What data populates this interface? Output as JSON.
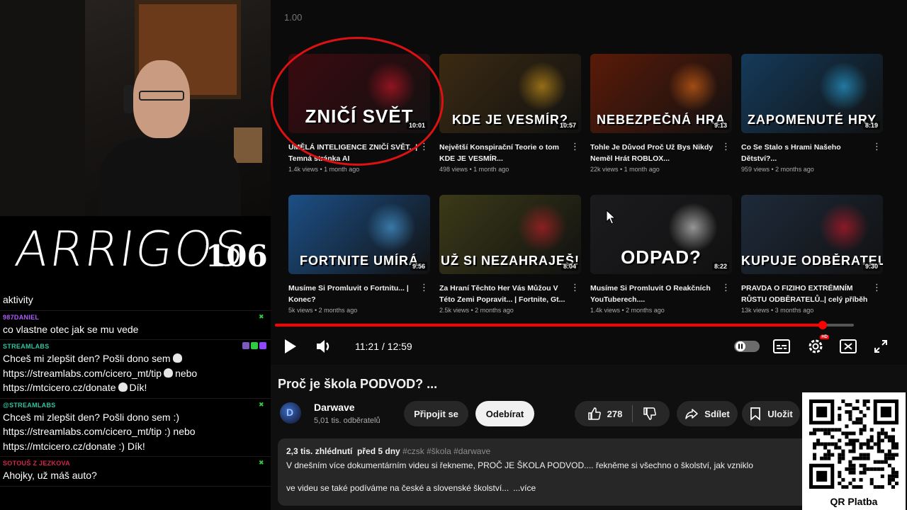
{
  "stream": {
    "logo_text": "ARRIGOS",
    "counter": "106"
  },
  "chat": {
    "messages": [
      {
        "user": "",
        "text": "aktivity",
        "user_color": "#9146ff"
      },
      {
        "user": "987DANIEL",
        "text": "co vlastne otec jak se mu vede",
        "user_color": "#b05cff"
      },
      {
        "user": "STREAMLABS",
        "text_parts": [
          "Chceš mi zlepšit den? Pošli dono sem",
          "https://streamlabs.com/cicero_mt/tip",
          "nebo",
          "https://mtcicero.cz/donate",
          "Dík!"
        ],
        "user_color": "#31c3a2"
      },
      {
        "user": "@STREAMLABS",
        "text": "Chceš mi zlepšit den? Pošli dono sem :) https://streamlabs.com/cicero_mt/tip :) nebo https://mtcicero.cz/donate :) Dík!",
        "user_color": "#31c3a2"
      },
      {
        "user": "SOTOUŠ Z JEZKOVA",
        "text": "Ahojky, už máš auto?",
        "user_color": "#d7264a"
      }
    ]
  },
  "player": {
    "speed": "1.00",
    "time": "11:21 / 12:59",
    "progress_fraction": 0.946,
    "buffered_fraction": 1.0
  },
  "endscreen": [
    {
      "thumb_text": "ZNIČÍ SVĚT",
      "duration": "10:01",
      "title": "UMĚLÁ INTELIGENCE ZNIČÍ SVĚT...| Temná stránka AI",
      "meta": "1.4k views • 1 month ago",
      "bg": "#3a0a0f",
      "accent": "#e8192c"
    },
    {
      "thumb_text": "KDE JE VESMÍR?",
      "duration": "10:57",
      "title": "Největší Konspirační Teorie o tom KDE JE VESMÍR...",
      "meta": "498 views • 1 month ago",
      "bg": "#3b2a12",
      "accent": "#f2b21b"
    },
    {
      "thumb_text": "NEBEZPEČNÁ HRA",
      "duration": "9:13",
      "title": "Tohle Je Důvod Proč Už Bys Nikdy Neměl Hrát ROBLOX...",
      "meta": "22k views • 1 month ago",
      "bg": "#5a1a08",
      "accent": "#ff7a1a"
    },
    {
      "thumb_text": "ZAPOMENUTÉ HRY",
      "duration": "8:19",
      "title": "Co Se Stalo s Hrami Našeho Dětství?...",
      "meta": "959 views • 2 months ago",
      "bg": "#143a5a",
      "accent": "#2ec0ff"
    },
    {
      "thumb_text": "FORTNITE UMÍRÁ",
      "duration": "9:56",
      "title": "Musíme Si Promluvit o Fortnitu... | Konec?",
      "meta": "5k views • 2 months ago",
      "bg": "#1c4f86",
      "accent": "#57b8ff"
    },
    {
      "thumb_text": "UŽ SI NEZAHRAJEŠ!",
      "duration": "8:04",
      "title": "Za Hraní Těchto Her Vás Můžou V Této Zemi Popravit... | Fortnite, Gt...",
      "meta": "2.5k views • 2 months ago",
      "bg": "#3b3a18",
      "accent": "#e01f2b"
    },
    {
      "thumb_text": "ODPAD?",
      "duration": "8:22",
      "title": "Musíme Si Promluvit O Reakčních YouTuberech....",
      "meta": "1.4k views • 2 months ago",
      "bg": "#1b1b1e",
      "accent": "#ffffff"
    },
    {
      "thumb_text": "KUPUJE ODBĚRATELE ?",
      "duration": "9:30",
      "title": "PRAVDA O FIZIHO EXTRÉMNÍM RŮSTU ODBĚRATELŮ..| celý příběh",
      "meta": "13k views • 3 months ago",
      "bg": "#1e2a3a",
      "accent": "#e8192c"
    }
  ],
  "video": {
    "title": "Proč je škola PODVOD? ...",
    "channel_name": "Darwave",
    "channel_subs": "5,01 tis. odběratelů",
    "channel_avatar_letter": "D",
    "join_label": "Připojit se",
    "subscribe_label": "Odebírat",
    "like_count": "278",
    "share_label": "Sdílet",
    "save_label": "Uložit",
    "views": "2,3 tis. zhlédnutí",
    "date": "před 5 dny",
    "tags": "#czsk #škola #darwave",
    "desc_line1": "V dnešním více dokumentárním videu si řekneme, PROČ JE ŠKOLA PODVOD.... řekněme si všechno o školství, jak vzniklo",
    "desc_line2": "ve videu se také podíváme na české a slovenské školství...",
    "more_label": "...více"
  },
  "qr": {
    "label": "QR Platba"
  },
  "colors": {
    "accent_red": "#ff0000",
    "bg": "#0f0f0f",
    "chip": "#272727"
  }
}
